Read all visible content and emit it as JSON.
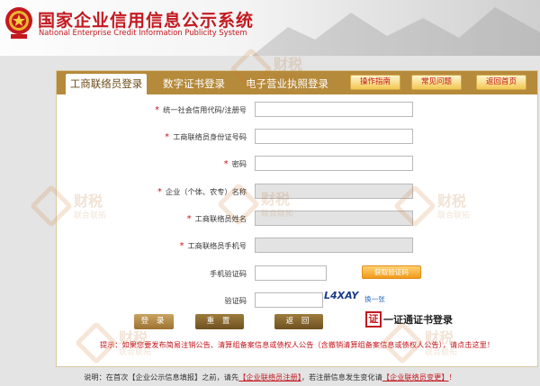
{
  "header": {
    "title_cn": "国家企业信用信息公示系统",
    "title_en": "National Enterprise Credit Information Publicity System"
  },
  "tabs": {
    "active": "工商联络员登录",
    "cert": "数字证书登录",
    "elicense": "电子营业执照登录"
  },
  "header_buttons": {
    "guide": "操作指南",
    "faq": "常见问题",
    "home": "返回首页"
  },
  "form": {
    "credit_code": "统一社会信用代码/注册号",
    "liaison_id": "工商联络员身份证号码",
    "password": "密码",
    "company_name": "企业（个体、农专）名称",
    "liaison_name": "工商联络员姓名",
    "liaison_phone": "工商联络员手机号",
    "sms_code": "手机验证码",
    "captcha": "验证码",
    "sms_button": "获取验证码",
    "captcha_text": "L4XAY",
    "captcha_refresh": "换一张"
  },
  "actions": {
    "login": "登 录",
    "reset": "重 置",
    "back": "返 回",
    "cert_icon": "证",
    "cert_login": "一证通证书登录"
  },
  "notice": "提示：如果您要发布简易注销公告、清算组备案信息或债权人公告（含撤销清算组备案信息或债权人公告），请点击这里！",
  "footer": {
    "p1": "说明：在首次【企业公示信息填报】之前，请先",
    "link1": "【企业联络员注册】",
    "p2": "，若注册信息发生变化请",
    "link2": "【企业联络员变更】",
    "p3": "！"
  },
  "watermark": {
    "t1": "财税",
    "t2": "联合联拓"
  },
  "icons": {
    "emblem": "national-emblem-icon",
    "cert": "certificate-icon"
  },
  "colors": {
    "brand_red": "#c4181f",
    "tab_gold": "#b58a3b"
  }
}
